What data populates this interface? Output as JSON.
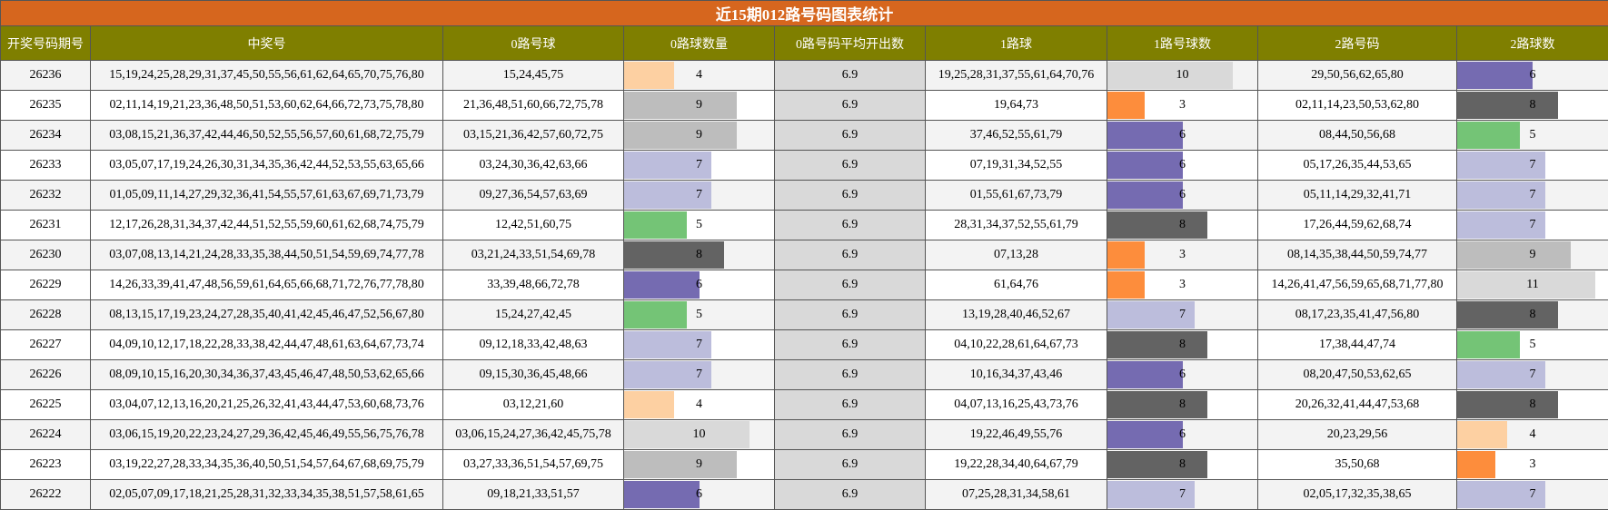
{
  "title": "近15期012路号码图表统计",
  "headers": [
    "开奖号码期号",
    "中奖号",
    "0路号球",
    "0路球数量",
    "0路号码平均开出数",
    "1路球",
    "1路号球数",
    "2路号码",
    "2路球数"
  ],
  "color_scale": {
    "3": "#fd8d3c",
    "4": "#fdd0a2",
    "5": "#74c476",
    "6": "#756bb1",
    "7": "#bcbddc",
    "8": "#636363",
    "9": "#bdbdbd",
    "10": "#d9d9d9",
    "11": "#d9d9d9"
  },
  "rows": [
    {
      "period": "26236",
      "numbers": "15,19,24,25,28,29,31,37,45,50,55,56,61,62,64,65,70,75,76,80",
      "route0": "15,24,45,75",
      "count0": 4,
      "avg0": "6.9",
      "route1": "19,25,28,31,37,55,61,64,70,76",
      "count1": 10,
      "route2": "29,50,56,62,65,80",
      "count2": 6
    },
    {
      "period": "26235",
      "numbers": "02,11,14,19,21,23,36,48,50,51,53,60,62,64,66,72,73,75,78,80",
      "route0": "21,36,48,51,60,66,72,75,78",
      "count0": 9,
      "avg0": "6.9",
      "route1": "19,64,73",
      "count1": 3,
      "route2": "02,11,14,23,50,53,62,80",
      "count2": 8
    },
    {
      "period": "26234",
      "numbers": "03,08,15,21,36,37,42,44,46,50,52,55,56,57,60,61,68,72,75,79",
      "route0": "03,15,21,36,42,57,60,72,75",
      "count0": 9,
      "avg0": "6.9",
      "route1": "37,46,52,55,61,79",
      "count1": 6,
      "route2": "08,44,50,56,68",
      "count2": 5
    },
    {
      "period": "26233",
      "numbers": "03,05,07,17,19,24,26,30,31,34,35,36,42,44,52,53,55,63,65,66",
      "route0": "03,24,30,36,42,63,66",
      "count0": 7,
      "avg0": "6.9",
      "route1": "07,19,31,34,52,55",
      "count1": 6,
      "route2": "05,17,26,35,44,53,65",
      "count2": 7
    },
    {
      "period": "26232",
      "numbers": "01,05,09,11,14,27,29,32,36,41,54,55,57,61,63,67,69,71,73,79",
      "route0": "09,27,36,54,57,63,69",
      "count0": 7,
      "avg0": "6.9",
      "route1": "01,55,61,67,73,79",
      "count1": 6,
      "route2": "05,11,14,29,32,41,71",
      "count2": 7
    },
    {
      "period": "26231",
      "numbers": "12,17,26,28,31,34,37,42,44,51,52,55,59,60,61,62,68,74,75,79",
      "route0": "12,42,51,60,75",
      "count0": 5,
      "avg0": "6.9",
      "route1": "28,31,34,37,52,55,61,79",
      "count1": 8,
      "route2": "17,26,44,59,62,68,74",
      "count2": 7
    },
    {
      "period": "26230",
      "numbers": "03,07,08,13,14,21,24,28,33,35,38,44,50,51,54,59,69,74,77,78",
      "route0": "03,21,24,33,51,54,69,78",
      "count0": 8,
      "avg0": "6.9",
      "route1": "07,13,28",
      "count1": 3,
      "route2": "08,14,35,38,44,50,59,74,77",
      "count2": 9
    },
    {
      "period": "26229",
      "numbers": "14,26,33,39,41,47,48,56,59,61,64,65,66,68,71,72,76,77,78,80",
      "route0": "33,39,48,66,72,78",
      "count0": 6,
      "avg0": "6.9",
      "route1": "61,64,76",
      "count1": 3,
      "route2": "14,26,41,47,56,59,65,68,71,77,80",
      "count2": 11
    },
    {
      "period": "26228",
      "numbers": "08,13,15,17,19,23,24,27,28,35,40,41,42,45,46,47,52,56,67,80",
      "route0": "15,24,27,42,45",
      "count0": 5,
      "avg0": "6.9",
      "route1": "13,19,28,40,46,52,67",
      "count1": 7,
      "route2": "08,17,23,35,41,47,56,80",
      "count2": 8
    },
    {
      "period": "26227",
      "numbers": "04,09,10,12,17,18,22,28,33,38,42,44,47,48,61,63,64,67,73,74",
      "route0": "09,12,18,33,42,48,63",
      "count0": 7,
      "avg0": "6.9",
      "route1": "04,10,22,28,61,64,67,73",
      "count1": 8,
      "route2": "17,38,44,47,74",
      "count2": 5
    },
    {
      "period": "26226",
      "numbers": "08,09,10,15,16,20,30,34,36,37,43,45,46,47,48,50,53,62,65,66",
      "route0": "09,15,30,36,45,48,66",
      "count0": 7,
      "avg0": "6.9",
      "route1": "10,16,34,37,43,46",
      "count1": 6,
      "route2": "08,20,47,50,53,62,65",
      "count2": 7
    },
    {
      "period": "26225",
      "numbers": "03,04,07,12,13,16,20,21,25,26,32,41,43,44,47,53,60,68,73,76",
      "route0": "03,12,21,60",
      "count0": 4,
      "avg0": "6.9",
      "route1": "04,07,13,16,25,43,73,76",
      "count1": 8,
      "route2": "20,26,32,41,44,47,53,68",
      "count2": 8
    },
    {
      "period": "26224",
      "numbers": "03,06,15,19,20,22,23,24,27,29,36,42,45,46,49,55,56,75,76,78",
      "route0": "03,06,15,24,27,36,42,45,75,78",
      "count0": 10,
      "avg0": "6.9",
      "route1": "19,22,46,49,55,76",
      "count1": 6,
      "route2": "20,23,29,56",
      "count2": 4
    },
    {
      "period": "26223",
      "numbers": "03,19,22,27,28,33,34,35,36,40,50,51,54,57,64,67,68,69,75,79",
      "route0": "03,27,33,36,51,54,57,69,75",
      "count0": 9,
      "avg0": "6.9",
      "route1": "19,22,28,34,40,64,67,79",
      "count1": 8,
      "route2": "35,50,68",
      "count2": 3
    },
    {
      "period": "26222",
      "numbers": "02,05,07,09,17,18,21,25,28,31,32,33,34,35,38,51,57,58,61,65",
      "route0": "09,18,21,33,51,57",
      "count0": 6,
      "avg0": "6.9",
      "route1": "07,25,28,31,34,58,61",
      "count1": 7,
      "route2": "02,05,17,32,35,38,65",
      "count2": 7
    }
  ]
}
